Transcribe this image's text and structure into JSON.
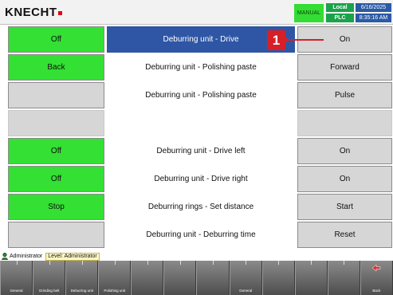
{
  "header": {
    "logo": "KNECHT",
    "mode": "MANUAL",
    "local": "Local",
    "plc": "PLC",
    "date": "6/16/2025",
    "time": "8:35:16 AM"
  },
  "callout": "1",
  "rows": [
    {
      "left": "Off",
      "label": "Deburring unit - Drive",
      "right": "On",
      "selected": true
    },
    {
      "left": "Back",
      "label": "Deburring unit - Polishing paste",
      "right": "Forward"
    },
    {
      "left": "",
      "label": "Deburring unit - Polishing paste",
      "right": "Pulse"
    },
    {
      "left": "",
      "label": "",
      "right": ""
    },
    {
      "left": "Off",
      "label": "Deburring unit - Drive left",
      "right": "On"
    },
    {
      "left": "Off",
      "label": "Deburring unit - Drive right",
      "right": "On"
    },
    {
      "left": "Stop",
      "label": "Deburring rings - Set distance",
      "right": "Start"
    },
    {
      "left": "",
      "label": "Deburring unit - Deburring time",
      "right": "Reset"
    }
  ],
  "status": {
    "user": "Administrator",
    "level": "Level: Administrator"
  },
  "softkeys": [
    {
      "label": "General"
    },
    {
      "label": "Grinding belt"
    },
    {
      "label": "Deburring unit"
    },
    {
      "label": "Polishing unit"
    },
    {
      "label": ""
    },
    {
      "label": ""
    },
    {
      "label": ""
    },
    {
      "label": "General"
    },
    {
      "label": ""
    },
    {
      "label": ""
    },
    {
      "label": ""
    },
    {
      "label": "Back"
    }
  ],
  "colors": {
    "green": "#33e033",
    "selected": "#2f56a5",
    "callout": "#d61f26"
  }
}
